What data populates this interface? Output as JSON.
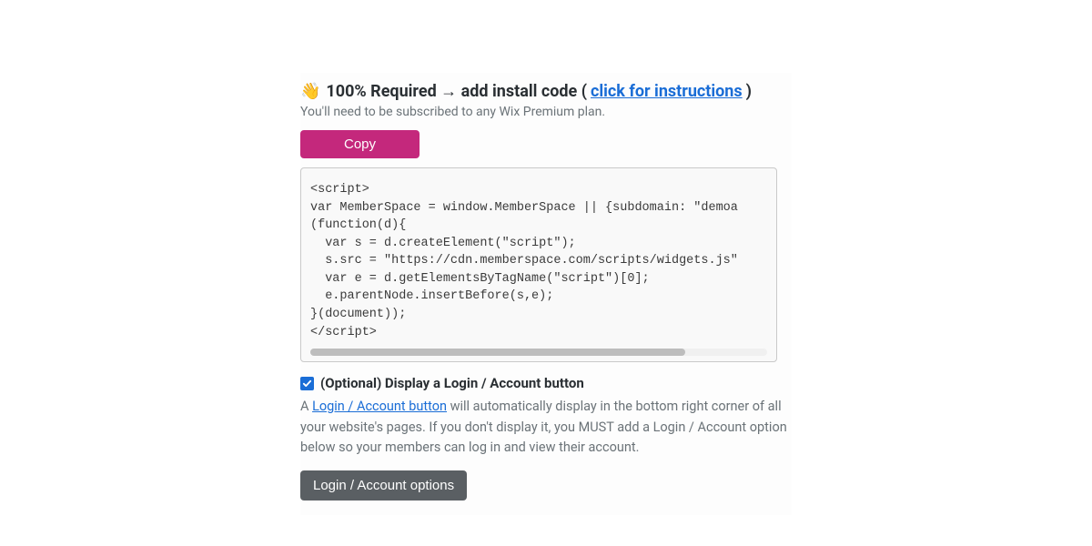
{
  "heading": {
    "emoji": "👋",
    "text_before_link": "100% Required → add install code (",
    "link_text": "click for instructions",
    "text_after_link": ")"
  },
  "subtext": "You'll need to be subscribed to any Wix Premium plan.",
  "copy_button": "Copy",
  "code_snippet": "<script>\nvar MemberSpace = window.MemberSpace || {subdomain: \"demoa\n(function(d){\n  var s = d.createElement(\"script\");\n  s.src = \"https://cdn.memberspace.com/scripts/widgets.js\"\n  var e = d.getElementsByTagName(\"script\")[0];\n  e.parentNode.insertBefore(s,e);\n}(document));\n</script>",
  "option": {
    "checked": true,
    "label": "(Optional) Display a Login / Account button",
    "desc_before": "A ",
    "desc_link": "Login / Account button",
    "desc_after": " will automatically display in the bottom right corner of all your website's pages. If you don't display it, you MUST add a Login / Account option below so your members can log in and view their account."
  },
  "login_options_button": "Login / Account options"
}
